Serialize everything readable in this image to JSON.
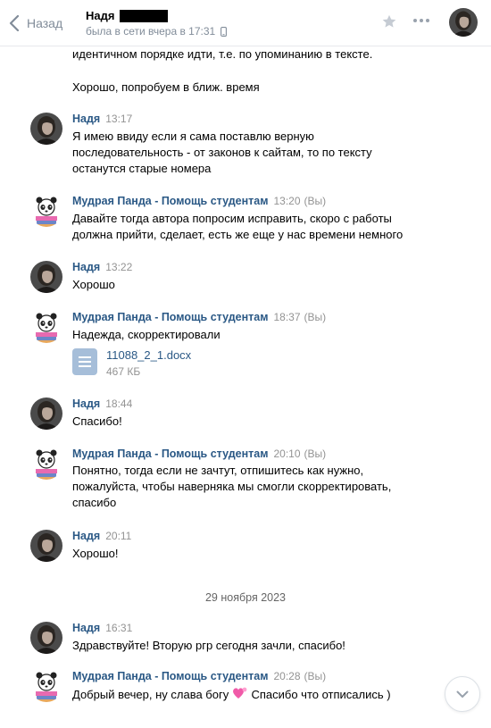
{
  "header": {
    "back_label": "Назад",
    "contact_name": "Надя",
    "status": "была в сети вчера в 17:31"
  },
  "fragments": {
    "line1": "идентичном порядке идти, т.е. по упоминанию в тексте.",
    "line2": "Хорошо, попробуем в ближ. время"
  },
  "messages": [
    {
      "author": "Надя",
      "time": "13:17",
      "you": "",
      "lines": [
        "Я имею ввиду если я сама поставлю верную",
        "последовательность - от законов к сайтам, то по тексту",
        "останутся старые номера"
      ]
    },
    {
      "author": "Мудрая Панда - Помощь студентам",
      "time": "13:20",
      "you": "(Вы)",
      "lines": [
        "Давайте тогда автора попросим исправить, скоро с работы",
        "должна прийти, сделает, есть же еще у нас времени немного"
      ]
    },
    {
      "author": "Надя",
      "time": "13:22",
      "you": "",
      "lines": [
        "Хорошо"
      ]
    },
    {
      "author": "Мудрая Панда - Помощь студентам",
      "time": "18:37",
      "you": "(Вы)",
      "lines": [
        "Надежда, скорректировали"
      ],
      "file": {
        "name": "11088_2_1.docx",
        "size": "467 КБ"
      }
    },
    {
      "author": "Надя",
      "time": "18:44",
      "you": "",
      "lines": [
        "Спасибо!"
      ]
    },
    {
      "author": "Мудрая Панда - Помощь студентам",
      "time": "20:10",
      "you": "(Вы)",
      "lines": [
        "Понятно, тогда если не зачтут, отпишитесь как нужно,",
        "пожалуйста, чтобы наверняка мы смогли скорректировать,",
        "спасибо"
      ]
    },
    {
      "author": "Надя",
      "time": "20:11",
      "you": "",
      "lines": [
        "Хорошо!"
      ]
    },
    {
      "author": "Надя",
      "time": "16:31",
      "you": "",
      "lines": [
        "Здравствуйте! Вторую ргр сегодня зачли, спасибо!"
      ]
    },
    {
      "author": "Мудрая Панда - Помощь студентам",
      "time": "20:28",
      "you": "(Вы)",
      "lines": [
        "Добрый вечер, ну слава богу",
        "Спасибо что отписались )"
      ]
    }
  ],
  "date_separator": "29 ноября 2023",
  "icons": {
    "back": "chevron-left-icon",
    "star": "star-icon",
    "more": "more-dots-icon",
    "phone": "phone-icon",
    "file": "document-icon",
    "heart": "heart-emoji",
    "scroll": "chevron-down-icon"
  },
  "colors": {
    "author": "#2a5885",
    "muted": "#939393",
    "file_icon": "#a6bed9"
  }
}
